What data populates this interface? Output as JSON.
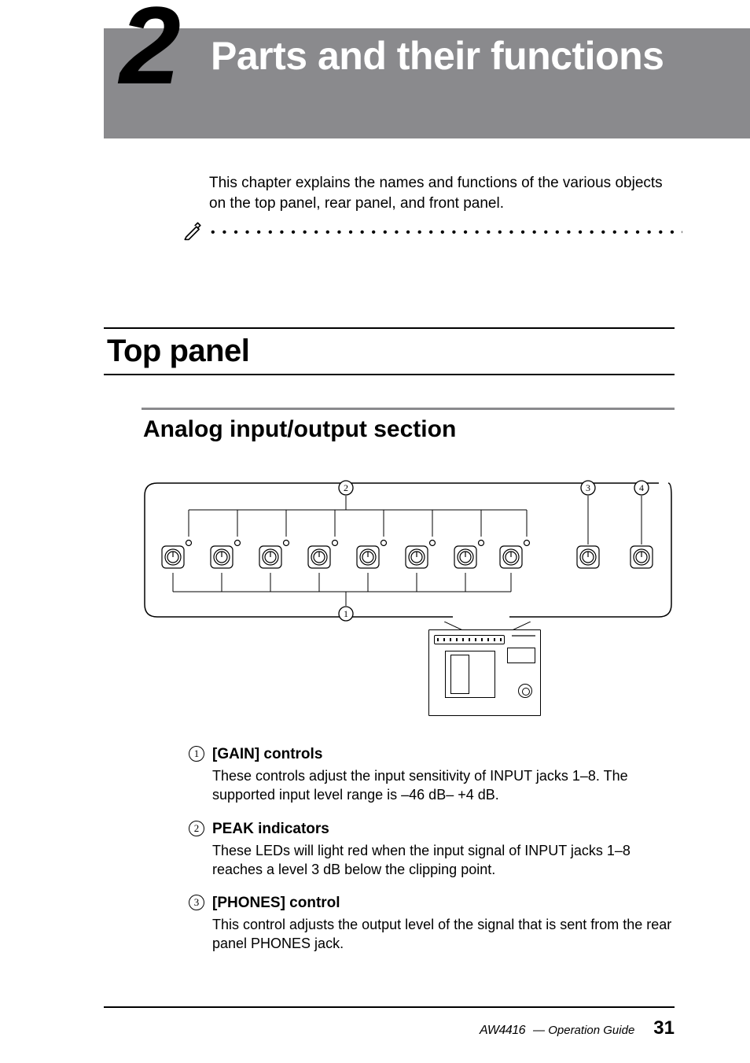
{
  "chapter": {
    "number": "2",
    "title": "Parts and their functions"
  },
  "intro": "This chapter explains the names and functions of the various objects on the top panel, rear panel, and front panel.",
  "section_h1": "Top panel",
  "section_h2": "Analog input/output section",
  "diagram": {
    "callouts": [
      "1",
      "2",
      "3",
      "4"
    ],
    "gain_knob_count": 8,
    "right_knob_count": 2
  },
  "definitions": [
    {
      "num": "1",
      "title": "[GAIN] controls",
      "body": "These controls adjust the input sensitivity of INPUT jacks 1–8. The supported input level range is –46 dB– +4 dB."
    },
    {
      "num": "2",
      "title": "PEAK indicators",
      "body": "These LEDs will light red when the input signal of INPUT jacks 1–8 reaches a level 3 dB below the clipping point."
    },
    {
      "num": "3",
      "title": "[PHONES] control",
      "body": "This control adjusts the output level of the signal that is sent from the rear panel PHONES jack."
    }
  ],
  "footer": {
    "product": "AW4416",
    "guide_label": "— Operation Guide",
    "page_number": "31"
  }
}
